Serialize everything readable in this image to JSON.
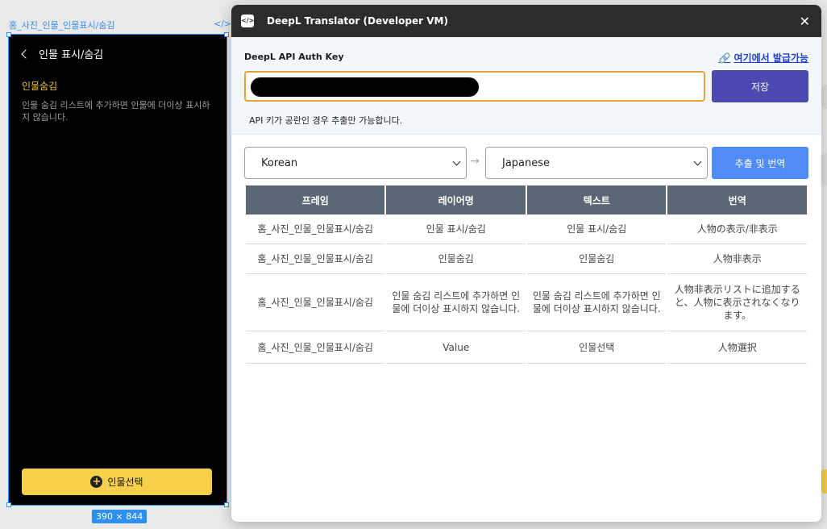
{
  "canvas": {
    "frame_label": "홈_사진_인물_인물표시/숨김",
    "code_icon": "</>",
    "frame": {
      "header_title": "인물 표시/숨김",
      "subtitle": "인물숨김",
      "description": "인물 숨김 리스트에 추가하면 인물에 더이상 표시하지 않습니다.",
      "button_label": "인물선택"
    },
    "size_badge": "390 × 844"
  },
  "plugin": {
    "title": "DeepL Translator (Developer VM)",
    "auth": {
      "label": "DeepL API Auth Key",
      "issue_link": "여기에서 발급가능",
      "save_label": "저장",
      "note": "API 키가 공란인 경우 추출만 가능합니다."
    },
    "source_lang": "Korean",
    "target_lang": "Japanese",
    "translate_label": "추출 및 번역",
    "table": {
      "headers": [
        "프레임",
        "레이어명",
        "텍스트",
        "번역"
      ],
      "rows": [
        [
          "홈_사진_인물_인물표시/숨김",
          "인물 표시/숨김",
          "인물 표시/숨김",
          "人物の表示/非表示"
        ],
        [
          "홈_사진_인물_인물표시/숨김",
          "인물숨김",
          "인물숨김",
          "人物非表示"
        ],
        [
          "홈_사진_인물_인물표시/숨김",
          "인물 숨김 리스트에 추가하면 인물에 더이상 표시하지 않습니다.",
          "인물 숨김 리스트에 추가하면 인물에 더이상 표시하지 않습니다.",
          "人物非表示リストに追加すると、人物に表示されなくなります。"
        ],
        [
          "홈_사진_인물_인물표시/숨김",
          "Value",
          "인물선택",
          "人物選択"
        ]
      ]
    }
  },
  "colors": {
    "titlebar": "#2c2c2c",
    "save_button": "#4a4ab0",
    "translate_button": "#4f8cf6",
    "table_header": "#5c6675",
    "frame_accent": "#f6cf4b",
    "input_border": "#e5a33a"
  },
  "icons": [
    "code-icon",
    "chevron-left-icon",
    "plus-circle-icon",
    "plugin-app-icon",
    "close-icon",
    "link-icon",
    "arrow-right-icon",
    "caret-down-icon"
  ]
}
